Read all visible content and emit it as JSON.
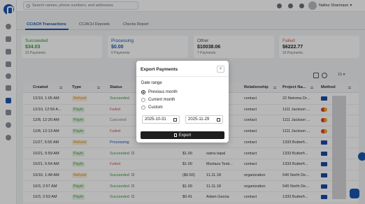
{
  "search": {
    "placeholder": "Search names, phone numbers, and addresses"
  },
  "user": {
    "name": "Nafiez Sharmaon"
  },
  "tabs": [
    {
      "label": "CC/ACH Transactions"
    },
    {
      "label": "CC/ACH Deposits"
    },
    {
      "label": "Checks Report"
    }
  ],
  "stats": [
    {
      "label": "Succeeded",
      "amount": "$34.03",
      "count": "23 Payments",
      "color": "#2e9a3a"
    },
    {
      "label": "Processing",
      "amount": "$0.00",
      "count": "0 Payments",
      "color": "#1a56b0"
    },
    {
      "label": "Other",
      "amount": "$10038.06",
      "count": "7 Payments",
      "color": "#555555"
    },
    {
      "label": "Failed",
      "amount": "$6222.77",
      "count": "33 Payments",
      "color": "#d9534f"
    }
  ],
  "table": {
    "page_size": "15",
    "headers": {
      "created": "Created",
      "type": "Type",
      "status": "Status",
      "relationship": "Relationship",
      "project": "Project Na...",
      "method": "Method"
    },
    "rows": [
      {
        "created": "12/10, 1:05 AM",
        "type": "Refund",
        "status": "Succeeded",
        "amount": "",
        "name": "",
        "relationship": "contact",
        "project": "22 Netoma Dr...",
        "method": "visa"
      },
      {
        "created": "12/10, 12:59 A...",
        "type": "Payin",
        "status": "Failed",
        "amount": "",
        "name": "",
        "relationship": "contact",
        "project": "1111 Jackson ...",
        "method": "mc"
      },
      {
        "created": "12/8, 12:20 AM",
        "type": "Payin",
        "status": "Canceled",
        "amount": "",
        "name": "",
        "relationship": "contact",
        "project": "1111 Jackson ...",
        "method": "mc"
      },
      {
        "created": "12/8, 12:13 AM",
        "type": "Payin",
        "status": "Failed",
        "amount": "",
        "name": "",
        "relationship": "contact",
        "project": "1111 Jackson ...",
        "method": "mc"
      },
      {
        "created": "11/27, 5:55 AM",
        "type": "Refund",
        "status": "Processing",
        "amount": "",
        "name": "",
        "relationship": "contact",
        "project": "1333 Butterfi...",
        "method": "visa"
      },
      {
        "created": "10/21, 5:59 AM",
        "type": "Payin",
        "status": "Succeeded",
        "amount": "$1.00",
        "name": "saina tapal",
        "relationship": "contact",
        "project": "1333 Butterfi...",
        "method": "visa"
      },
      {
        "created": "10/21, 5:54 AM",
        "type": "Payin",
        "status": "Failed",
        "amount": "$1.00",
        "name": "Murtaza Testi...",
        "relationship": "contact",
        "project": "1333 Butterfi...",
        "method": "visa"
      },
      {
        "created": "10/16, 1:48 AM",
        "type": "Refund",
        "status": "Succeeded",
        "amount": "($0.50)",
        "name": "11.11.18",
        "relationship": "organization",
        "project": "540 North De...",
        "method": "visa"
      },
      {
        "created": "10/3, 2:57 AM",
        "type": "Payin",
        "status": "Succeeded",
        "amount": "$1.00",
        "name": "11.11.18",
        "relationship": "organization",
        "project": "540 North De...",
        "method": "visa"
      },
      {
        "created": "10/3, 2:53 AM",
        "type": "Payin",
        "status": "Succeeded",
        "amount": "$0.41",
        "name": "Adam Garcia",
        "relationship": "contact",
        "project": "1333 Butterfi...",
        "method": "visa"
      }
    ]
  },
  "modal": {
    "title": "Export Payments",
    "close": "×",
    "date_range_label": "Date range",
    "options": [
      {
        "label": "Previous month",
        "selected": true
      },
      {
        "label": "Current month",
        "selected": false
      },
      {
        "label": "Custom",
        "selected": false
      }
    ],
    "start_date": "2025-10-31",
    "end_date": "2025-11-29",
    "export_label": "Export"
  }
}
